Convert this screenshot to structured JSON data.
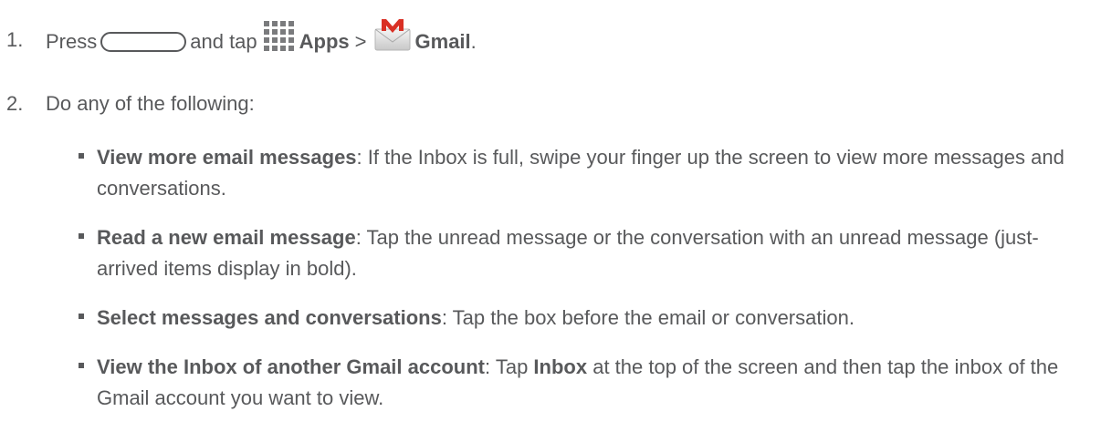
{
  "steps": [
    {
      "num": "1.",
      "press": "Press",
      "and_tap": "and tap",
      "apps_label": "Apps",
      "separator": ">",
      "gmail_label": "Gmail",
      "end": "."
    },
    {
      "num": "2.",
      "text": "Do any of the following:"
    }
  ],
  "bullets": [
    {
      "title": "View more email messages",
      "text": ": If the Inbox is full, swipe your finger up the screen to view more messages and conversations."
    },
    {
      "title": "Read a new email message",
      "text": ": Tap the unread message or the conversation with an unread message (just-arrived items display in bold)."
    },
    {
      "title": "Select messages and conversations",
      "text": ": Tap the box before the email or conversation."
    },
    {
      "title": "View the Inbox of another Gmail account",
      "text_a": ": Tap ",
      "inline_bold": "Inbox",
      "text_b": " at the top of the screen and then tap the inbox of the Gmail account you want to view."
    }
  ],
  "icons": {
    "home_key": "home-key-icon",
    "apps": "apps-grid-icon",
    "gmail": "gmail-envelope-icon"
  },
  "colors": {
    "text": "#58595b",
    "gmail_red": "#d93025",
    "apps_grid": "#7a7b7d"
  }
}
